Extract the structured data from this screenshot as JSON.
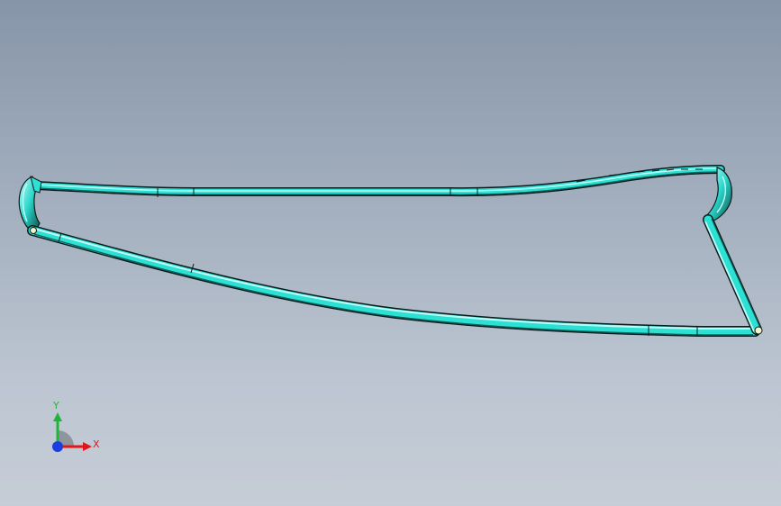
{
  "viewport": {
    "background_top": "#8795a9",
    "background_bottom": "#c6cdd7"
  },
  "model": {
    "tube_color": "#2de0d4",
    "tube_dark": "#0e5f5a",
    "tube_highlight": "#bffcf8",
    "edge_color": "#0b1a1a"
  },
  "triad": {
    "x_label": "X",
    "y_label": "Y",
    "x_color": "#e0161b",
    "y_color": "#1fb53b",
    "z_color": "#1a3fe0"
  }
}
